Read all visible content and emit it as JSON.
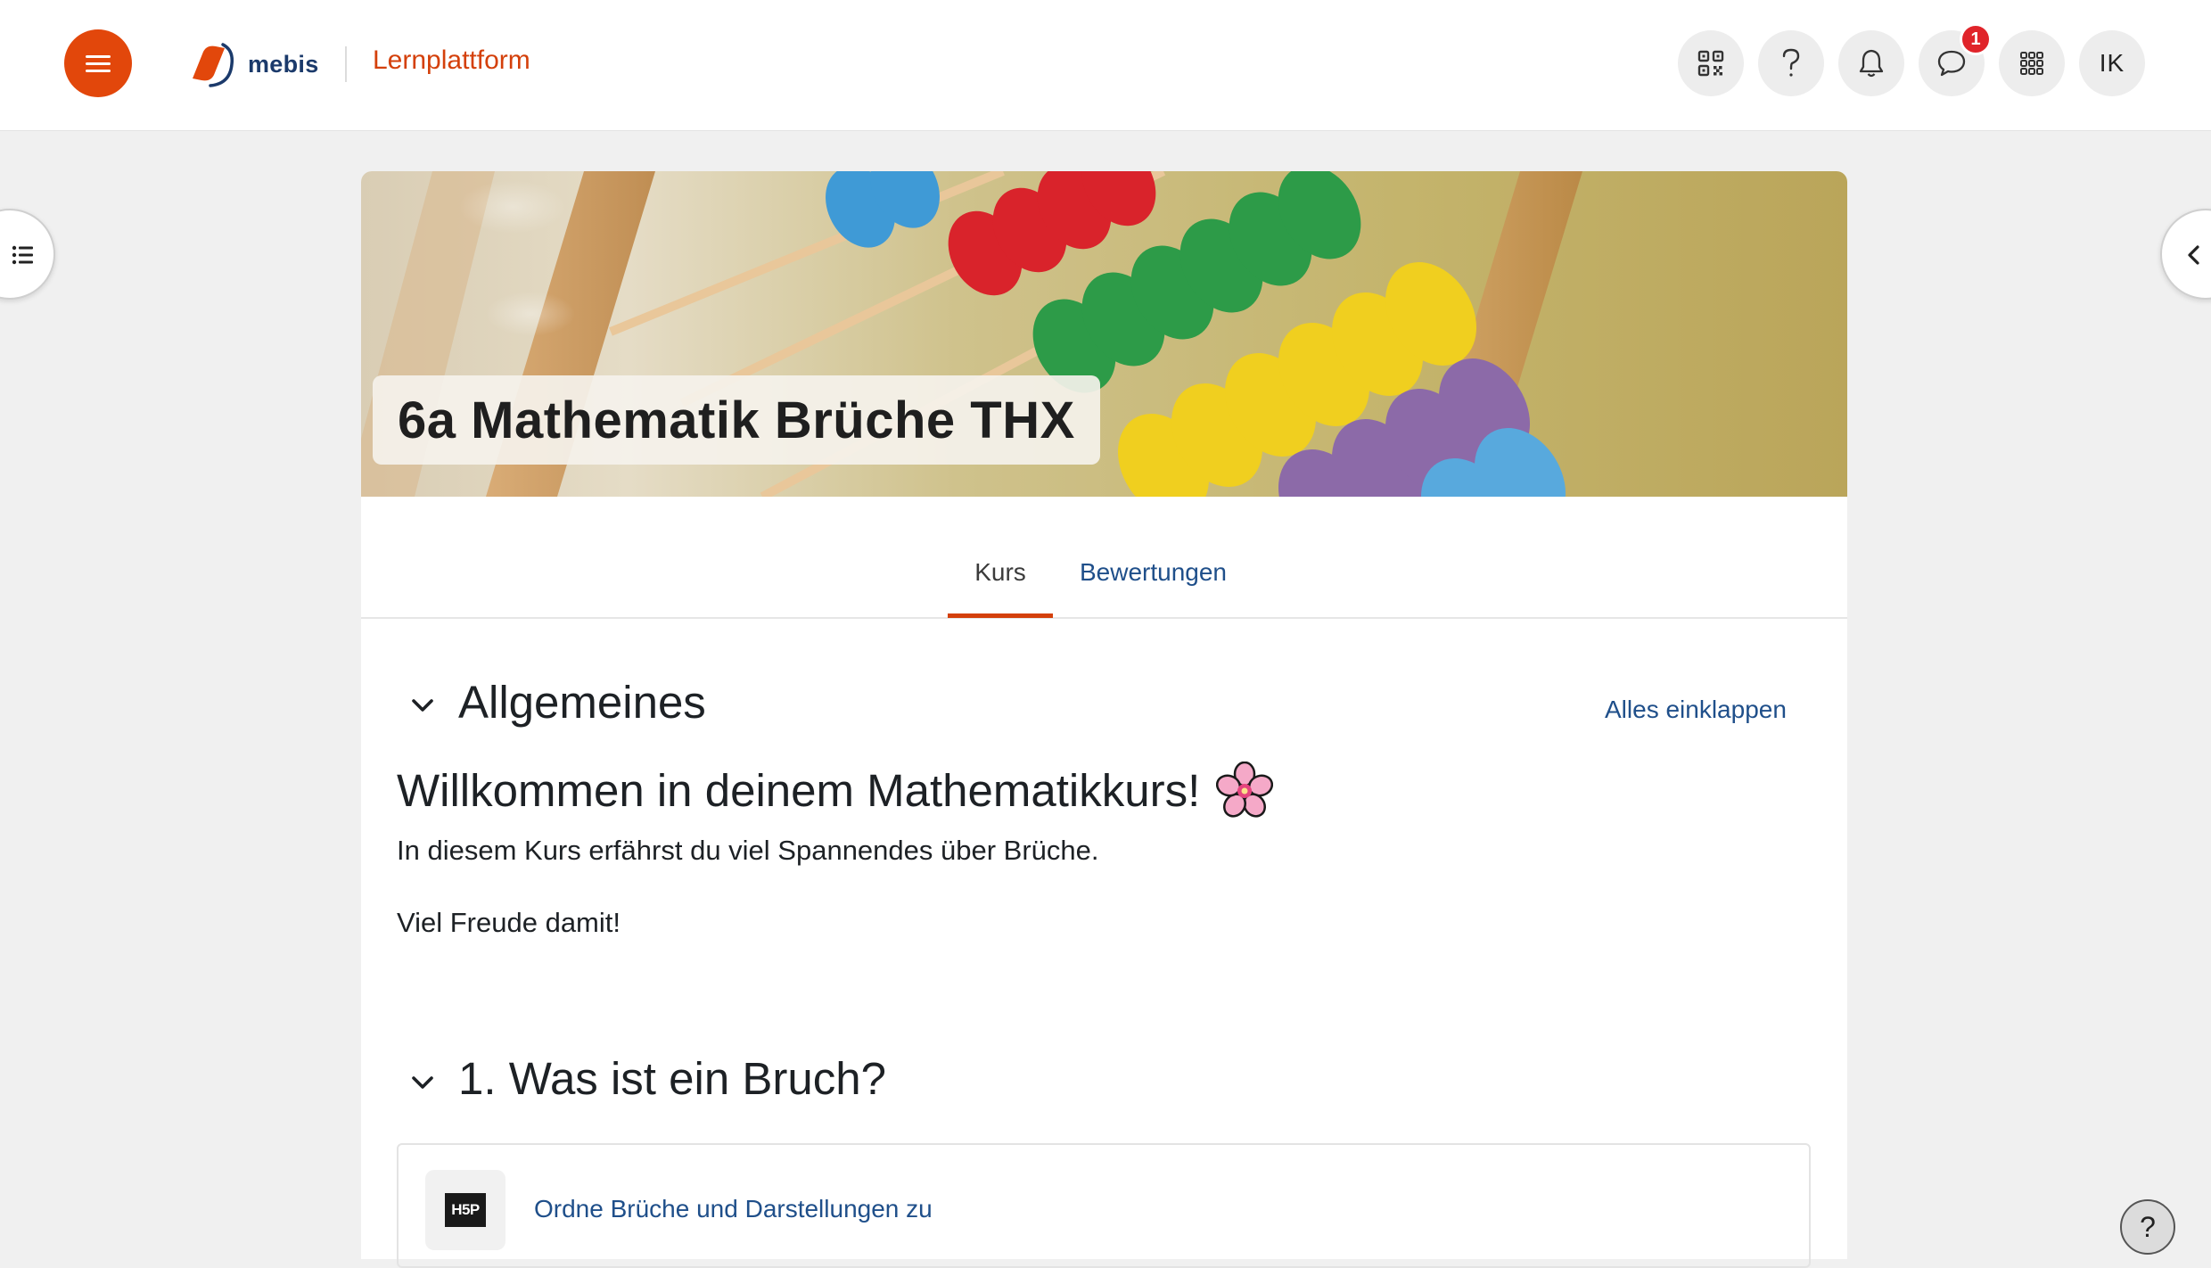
{
  "header": {
    "brand": "mebis",
    "platform": "Lernplattform",
    "icons": [
      "qr-code-icon",
      "help-icon",
      "bell-icon",
      "chat-icon",
      "apps-grid-icon"
    ],
    "chat_badge": "1",
    "user_initials": "IK",
    "accent": "#e2470b"
  },
  "course": {
    "title": "6a Mathematik Brüche THX"
  },
  "tabs": [
    {
      "label": "Kurs",
      "active": true
    },
    {
      "label": "Bewertungen",
      "active": false
    }
  ],
  "sections": [
    {
      "title": "Allgemeines"
    },
    {
      "title": "1. Was ist ein Bruch?"
    }
  ],
  "collapse_all": "Alles einklappen",
  "welcome": {
    "heading": "Willkommen in deinem Mathematikkurs!",
    "emoji": "🌸",
    "paragraph1": "In diesem Kurs erfährst du viel Spannendes über Brüche.",
    "paragraph2": "Viel Freude damit!"
  },
  "activity": {
    "icon_label": "H5P",
    "link": "Ordne Brüche und Darstellungen zu"
  },
  "help_fab": "?"
}
